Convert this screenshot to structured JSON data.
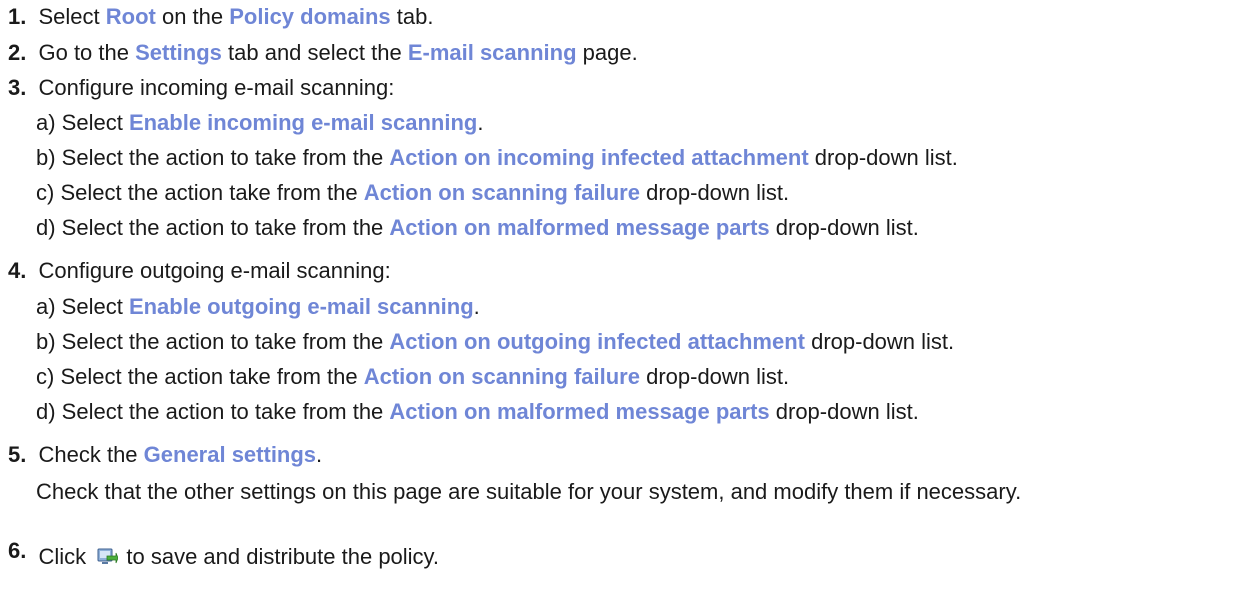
{
  "steps": {
    "s1": {
      "num": "1.",
      "t1": "Select ",
      "h1": "Root",
      "t2": " on the ",
      "h2": "Policy domains",
      "t3": " tab."
    },
    "s2": {
      "num": "2.",
      "t1": "Go to the ",
      "h1": "Settings",
      "t2": " tab and select the ",
      "h2": "E-mail scanning",
      "t3": " page."
    },
    "s3": {
      "num": "3.",
      "text": "Configure incoming e-mail scanning:",
      "a": {
        "t1": "a) Select ",
        "h1": "Enable incoming e-mail scanning",
        "t2": "."
      },
      "b": {
        "t1": "b) Select the action to take from the ",
        "h1": "Action on incoming infected attachment",
        "t2": " drop-down list."
      },
      "c": {
        "t1": "c) Select the action take from the ",
        "h1": "Action on scanning failure",
        "t2": " drop-down list."
      },
      "d": {
        "t1": "d) Select the action to take from the ",
        "h1": "Action on malformed message parts",
        "t2": " drop-down list."
      }
    },
    "s4": {
      "num": "4.",
      "text": "Configure outgoing e-mail scanning:",
      "a": {
        "t1": "a) Select ",
        "h1": "Enable outgoing e-mail scanning",
        "t2": "."
      },
      "b": {
        "t1": "b) Select the action to take from the ",
        "h1": "Action on outgoing infected attachment",
        "t2": " drop-down list."
      },
      "c": {
        "t1": "c) Select the action take from the ",
        "h1": "Action on scanning failure",
        "t2": " drop-down list."
      },
      "d": {
        "t1": "d) Select the action to take from the ",
        "h1": "Action on malformed message parts",
        "t2": " drop-down list."
      }
    },
    "s5": {
      "num": "5.",
      "t1": "Check the ",
      "h1": "General settings",
      "t2": ".",
      "note": "Check that the other settings on this page are suitable for your system, and modify them if necessary."
    },
    "s6": {
      "num": "6.",
      "t1": "Click ",
      "icon": "save-distribute-icon",
      "t2": " to save and distribute the policy."
    }
  }
}
